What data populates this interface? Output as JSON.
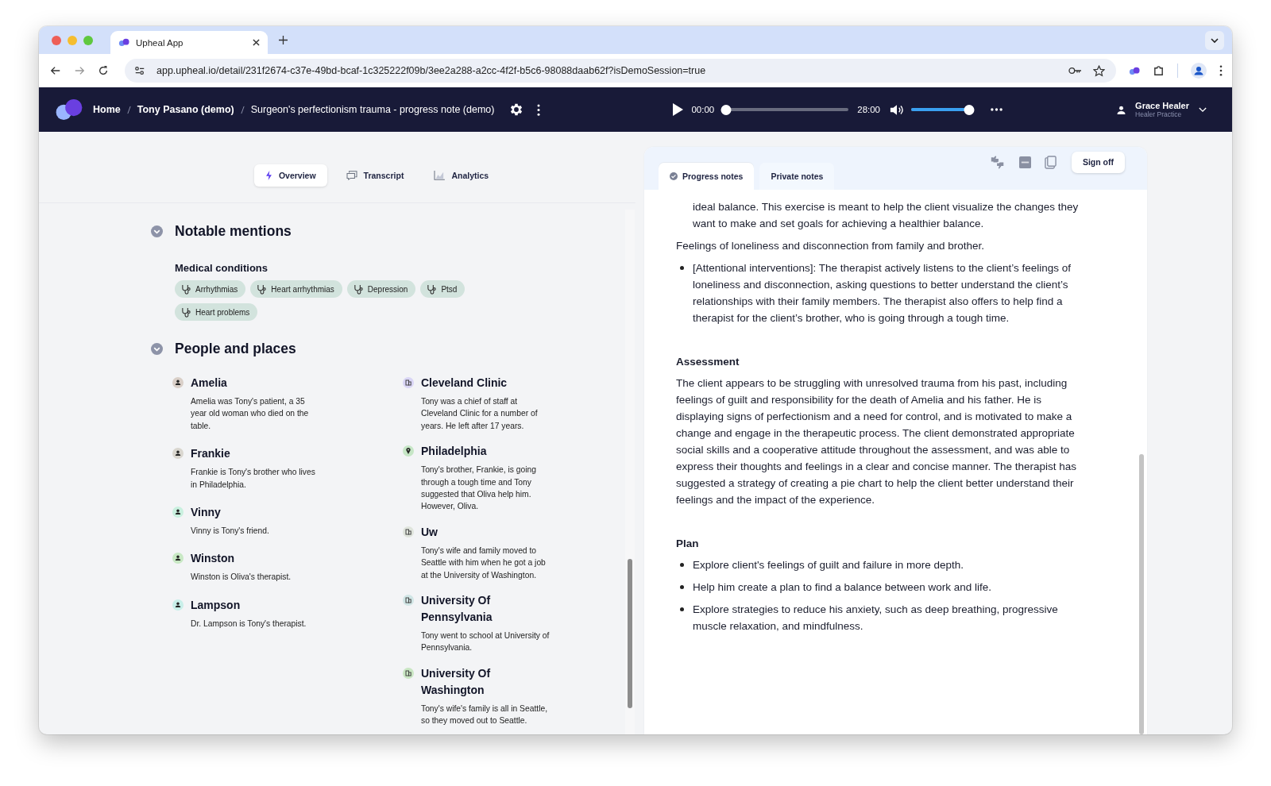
{
  "browser": {
    "tab_title": "Upheal App",
    "url": "app.upheal.io/detail/231f2674-c37e-49bd-bcaf-1c325222f09b/3ee2a288-a2cc-4f2f-b5c6-98088daab62f?isDemoSession=true"
  },
  "app_header": {
    "breadcrumbs": [
      "Home",
      "Tony Pasano (demo)",
      "Surgeon's perfectionism trauma - progress note (demo)"
    ],
    "player": {
      "current_time": "00:00",
      "duration": "28:00",
      "progress": {
        "level": 0
      },
      "volume": {
        "level": 1
      }
    },
    "user": {
      "name": "Grace Healer",
      "org": "Healer Practice"
    }
  },
  "view_tabs": [
    {
      "label": "Overview",
      "selected": true,
      "kind": "bolt"
    },
    {
      "label": "Transcript",
      "selected": false,
      "kind": "chat"
    },
    {
      "label": "Analytics",
      "selected": false,
      "kind": "chart"
    }
  ],
  "notable_mentions": {
    "title": "Notable mentions",
    "expanded": true,
    "groups": [
      {
        "title": "Medical conditions",
        "chips": [
          "Arrhythmias",
          "Heart arrhythmias",
          "Depression",
          "Ptsd",
          "Heart problems"
        ]
      }
    ]
  },
  "people_and_places": {
    "title": "People and places",
    "expanded": true,
    "columns": [
      [
        {
          "name": "Amelia",
          "kind": "person",
          "color": "#d9cfc8",
          "description": "Amelia was Tony's patient, a 35 year old woman who died on the table."
        },
        {
          "name": "Frankie",
          "kind": "person",
          "color": "#d9d6cf",
          "description": "Frankie is Tony's brother who lives in Philadelphia."
        },
        {
          "name": "Vinny",
          "kind": "person",
          "color": "#c9f0df",
          "description": "Vinny is Tony's friend."
        },
        {
          "name": "Winston",
          "kind": "person",
          "color": "#c8e8c4",
          "description": "Winston is Oliva's therapist."
        },
        {
          "name": "Lampson",
          "kind": "person",
          "color": "#c8efe9",
          "description": "Dr. Lampson is Tony's therapist."
        }
      ],
      [
        {
          "name": "Cleveland Clinic",
          "kind": "organization",
          "color": "#d9d5f5",
          "description": "Tony was a chief of staff at Cleveland Clinic for a number of years. He left after 17 years."
        },
        {
          "name": "Philadelphia",
          "kind": "place",
          "color": "#c6e6c6",
          "description": "Tony's brother, Frankie, is going through a tough time and Tony suggested that Oliva help him. However, Oliva."
        },
        {
          "name": "Uw",
          "kind": "organization",
          "color": "#dfe4dc",
          "description": "Tony's wife and family moved to Seattle with him when he got a job at the University of Washington."
        },
        {
          "name": "University Of Pennsylvania",
          "kind": "organization",
          "color": "#d0e5e5",
          "description": "Tony went to school at University of Pennsylvania."
        },
        {
          "name": "University Of Washington",
          "kind": "organization",
          "color": "#c9e6c3",
          "description": "Tony's wife's family is all in Seattle, so they moved out to Seattle."
        }
      ]
    ]
  },
  "note_tabs": [
    {
      "label": "Progress notes",
      "selected": true
    },
    {
      "label": "Private notes",
      "selected": false
    }
  ],
  "note_actions": {
    "sign_off": "Sign off"
  },
  "note_blocks": [
    {
      "kind": "continuation",
      "text": "ideal balance. This exercise is meant to help the client visualize the changes they want to make and set goals for achieving a healthier balance."
    },
    {
      "kind": "paragraph",
      "text": "Feelings of loneliness and disconnection from family and brother."
    },
    {
      "kind": "bullets",
      "items": [
        "[Attentional interventions]: The therapist actively listens to the client’s feelings of loneliness and disconnection, asking questions to better understand the client’s relationships with their family members. The therapist also offers to help find a therapist for the client’s brother, who is going through a tough time."
      ]
    },
    {
      "kind": "heading",
      "text": "Assessment"
    },
    {
      "kind": "paragraph",
      "text": "The client appears to be struggling with unresolved trauma from his past, including feelings of guilt and responsibility for the death of Amelia and his father. He is displaying signs of perfectionism and a need for control, and is motivated to make a change and engage in the therapeutic process. The client demonstrated appropriate social skills and a cooperative attitude throughout the assessment, and was able to express their thoughts and feelings in a clear and concise manner. The therapist has suggested a strategy of creating a pie chart to help the client better understand their feelings and the impact of the experience."
    },
    {
      "kind": "heading",
      "text": "Plan"
    },
    {
      "kind": "bullets",
      "items": [
        "Explore client's feelings of guilt and failure in more depth.",
        "Help him create a plan to find a balance between work and life.",
        "Explore strategies to reduce his anxiety, such as deep breathing, progressive muscle relaxation, and mindfulness."
      ]
    }
  ]
}
